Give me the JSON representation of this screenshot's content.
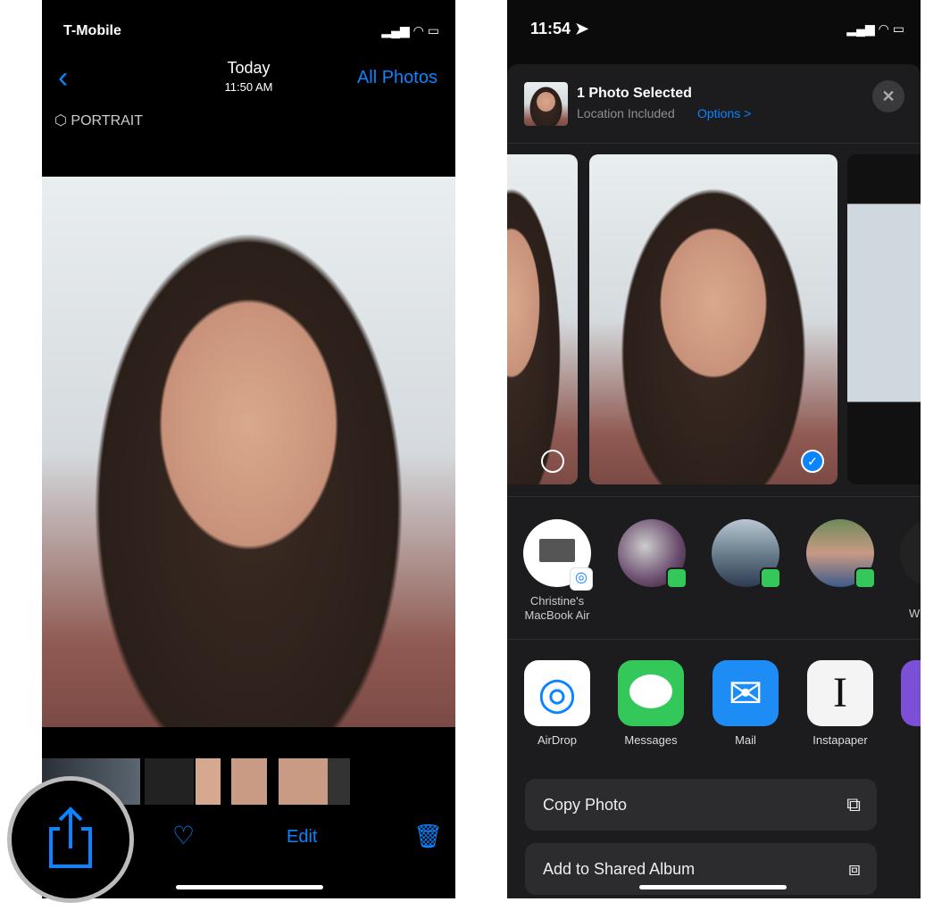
{
  "left": {
    "status": {
      "carrier": "T-Mobile"
    },
    "nav": {
      "title": "Today",
      "subtitle": "11:50 AM",
      "all_photos": "All Photos"
    },
    "portrait_label": "PORTRAIT",
    "toolbar": {
      "edit": "Edit"
    }
  },
  "right": {
    "status": {
      "time": "11:54"
    },
    "header": {
      "title": "1 Photo Selected",
      "subtitle": "Location Included",
      "options": "Options >"
    },
    "people": [
      {
        "name_line1": "Christine's",
        "name_line2": "MacBook Air"
      },
      {
        "name_line1": "W"
      }
    ],
    "apps": [
      {
        "label": "AirDrop"
      },
      {
        "label": "Messages"
      },
      {
        "label": "Mail"
      },
      {
        "label": "Instapaper"
      }
    ],
    "actions": [
      {
        "label": "Copy Photo"
      },
      {
        "label": "Add to Shared Album"
      }
    ]
  },
  "colors": {
    "accent": "#0a84ff",
    "messages": "#34c759",
    "sheet": "#1c1c1e"
  }
}
